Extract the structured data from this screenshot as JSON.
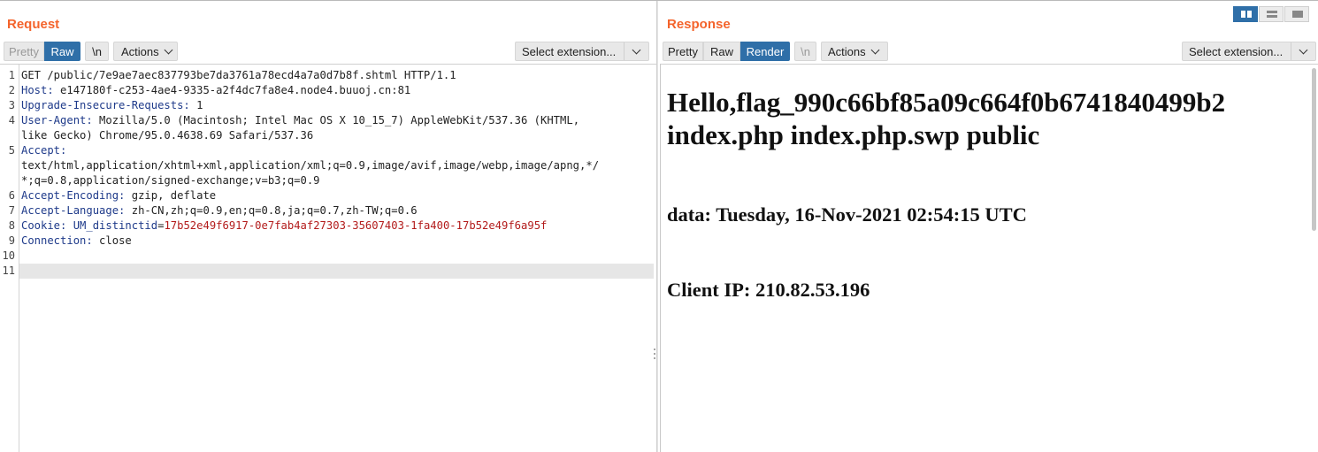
{
  "request": {
    "title": "Request",
    "tabs": {
      "pretty": "Pretty",
      "raw": "Raw",
      "newline": "\\n"
    },
    "actions": "Actions",
    "select_extension": "Select extension...",
    "line_numbers": [
      "1",
      "2",
      "3",
      "4",
      "",
      "5",
      "",
      "",
      "6",
      "7",
      "8",
      "9",
      "10",
      "11"
    ],
    "lines": {
      "l1": "GET /public/7e9ae7aec837793be7da3761a78ecd4a7a0d7b8f.shtml HTTP/1.1",
      "l2k": "Host:",
      "l2v": " e147180f-c253-4ae4-9335-a2f4dc7fa8e4.node4.buuoj.cn:81",
      "l3k": "Upgrade-Insecure-Requests:",
      "l3v": " 1",
      "l4k": "User-Agent:",
      "l4v": " Mozilla/5.0 (Macintosh; Intel Mac OS X 10_15_7) AppleWebKit/537.36 (KHTML,",
      "l4b": "like Gecko) Chrome/95.0.4638.69 Safari/537.36",
      "l5k": "Accept:",
      "l5b": "text/html,application/xhtml+xml,application/xml;q=0.9,image/avif,image/webp,image/apng,*/",
      "l5c": "*;q=0.8,application/signed-exchange;v=b3;q=0.9",
      "l6k": "Accept-Encoding:",
      "l6v": " gzip, deflate",
      "l7k": "Accept-Language:",
      "l7v": " zh-CN,zh;q=0.9,en;q=0.8,ja;q=0.7,zh-TW;q=0.6",
      "l8k": "Cookie:",
      "l8ck": " UM_distinctid",
      "l8eq": "=",
      "l8cv": "17b52e49f6917-0e7fab4af27303-35607403-1fa400-17b52e49f6a95f",
      "l9k": "Connection:",
      "l9v": " close"
    }
  },
  "response": {
    "title": "Response",
    "tabs": {
      "pretty": "Pretty",
      "raw": "Raw",
      "render": "Render",
      "newline": "\\n"
    },
    "actions": "Actions",
    "select_extension": "Select extension...",
    "render": {
      "heading_line1": "Hello,flag_990c66bf85a09c664f0b6741840499b2",
      "heading_line2": "index.php index.php.swp public",
      "date": "data: Tuesday, 16-Nov-2021 02:54:15 UTC",
      "client_ip": "Client IP: 210.82.53.196"
    }
  },
  "layout_toggle": {
    "active": "side-by-side",
    "options": [
      "side-by-side",
      "stacked",
      "tabs"
    ]
  },
  "colors": {
    "accent": "#f4642c",
    "active_tab": "#2f6fa8",
    "header_key": "#1e3a8a",
    "cookie_value": "#b31b1b"
  }
}
